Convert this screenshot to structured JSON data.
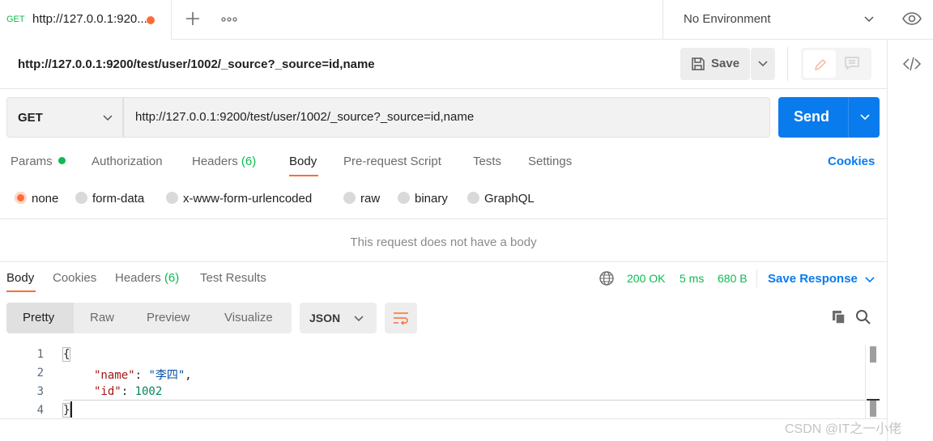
{
  "tabbar": {
    "tab": {
      "method": "GET",
      "title": "http://127.0.0.1:920..."
    },
    "environment": "No Environment"
  },
  "request": {
    "title": "http://127.0.0.1:9200/test/user/1002/_source?_source=id,name",
    "save_label": "Save",
    "method": "GET",
    "url": "http://127.0.0.1:9200/test/user/1002/_source?_source=id,name",
    "send_label": "Send",
    "tabs": [
      {
        "label": "Params"
      },
      {
        "label": "Authorization"
      },
      {
        "label": "Headers",
        "count": "(6)"
      },
      {
        "label": "Body"
      },
      {
        "label": "Pre-request Script"
      },
      {
        "label": "Tests"
      },
      {
        "label": "Settings"
      }
    ],
    "cookies_label": "Cookies",
    "body_types": [
      "none",
      "form-data",
      "x-www-form-urlencoded",
      "raw",
      "binary",
      "GraphQL"
    ],
    "selected_body_type": "none",
    "no_body_message": "This request does not have a body"
  },
  "response": {
    "tabs": [
      {
        "label": "Body"
      },
      {
        "label": "Cookies"
      },
      {
        "label": "Headers",
        "count": "(6)"
      },
      {
        "label": "Test Results"
      }
    ],
    "status": "200 OK",
    "time": "5 ms",
    "size": "680 B",
    "save_response_label": "Save Response",
    "view_modes": [
      "Pretty",
      "Raw",
      "Preview",
      "Visualize"
    ],
    "format": "JSON",
    "line_numbers": [
      "1",
      "2",
      "3",
      "4"
    ],
    "body": {
      "open_brace": "{",
      "key1": "\"name\"",
      "val1": "\"李四\"",
      "key2": "\"id\"",
      "val2": "1002",
      "close_brace": "}"
    }
  },
  "watermark": "CSDN @IT之一小佬",
  "colors": {
    "accent_orange": "#ff6c37",
    "send_blue": "#097bed",
    "success_green": "#0cbb52"
  }
}
